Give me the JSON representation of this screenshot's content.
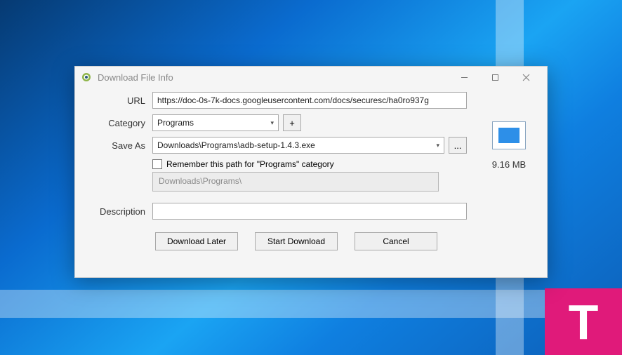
{
  "window": {
    "title": "Download File Info"
  },
  "labels": {
    "url": "URL",
    "category": "Category",
    "saveas": "Save As",
    "description": "Description"
  },
  "url": {
    "value": "https://doc-0s-7k-docs.googleusercontent.com/docs/securesc/ha0ro937g"
  },
  "category": {
    "selected": "Programs",
    "add_label": "+"
  },
  "saveas": {
    "path": "Downloads\\Programs\\adb-setup-1.4.3.exe",
    "browse_label": "...",
    "remember_label": "Remember this path for \"Programs\" category",
    "basepath": "Downloads\\Programs\\"
  },
  "description": {
    "value": ""
  },
  "buttons": {
    "later": "Download Later",
    "start": "Start Download",
    "cancel": "Cancel"
  },
  "file": {
    "size": "9.16  MB"
  },
  "watermark": "T"
}
